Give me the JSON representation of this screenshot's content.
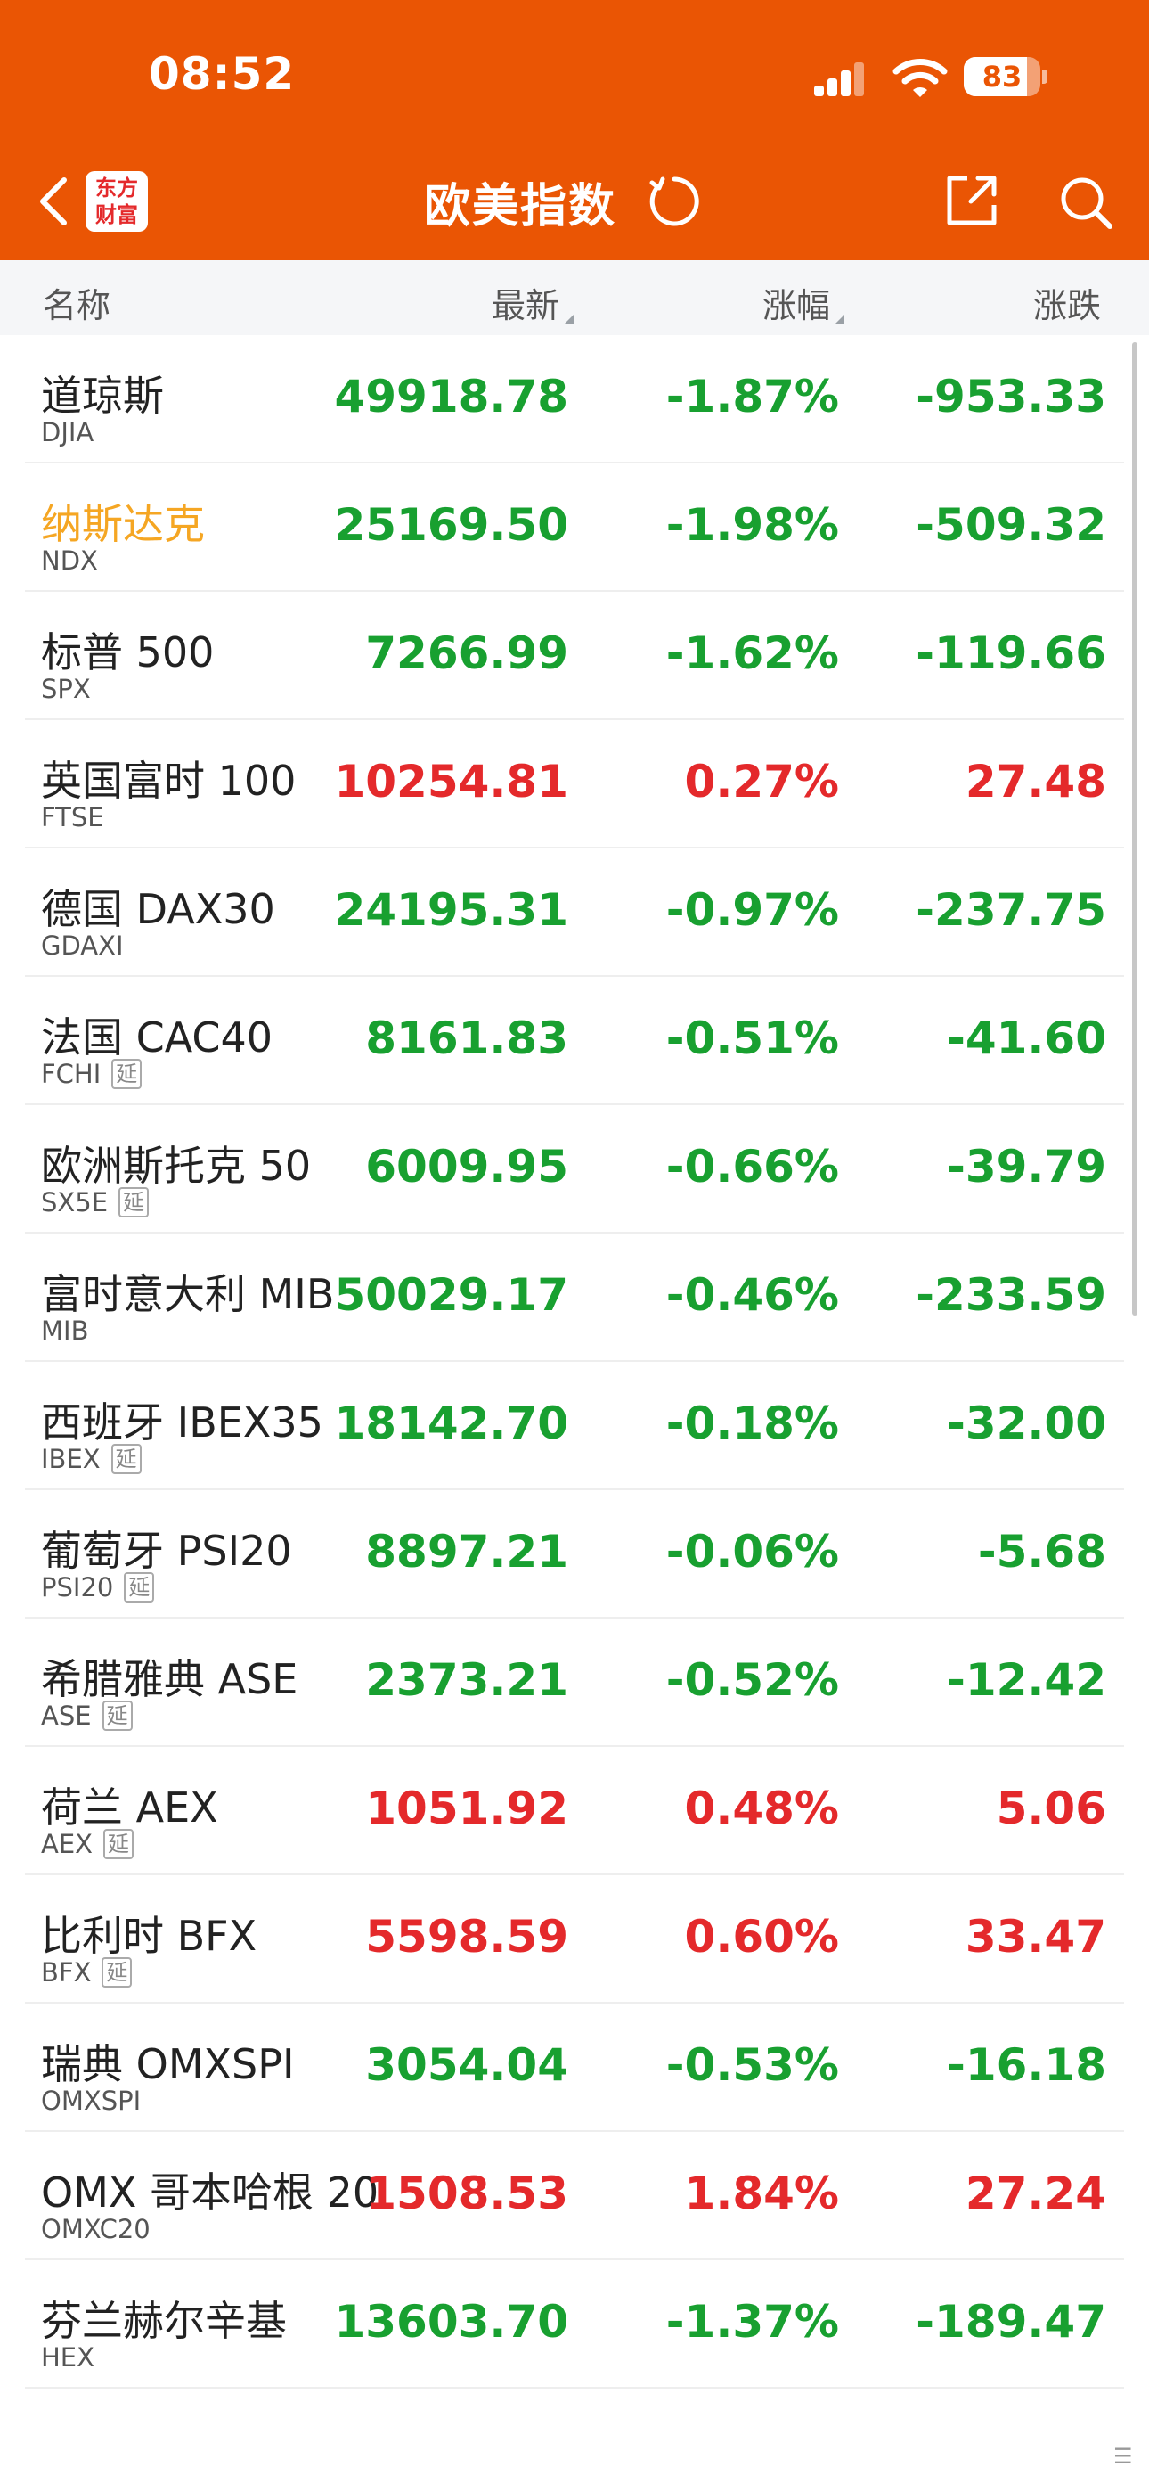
{
  "status": {
    "time": "08:52",
    "battery": "83",
    "battery_level": 0.83
  },
  "nav": {
    "title": "欧美指数",
    "logo_line1": "东方",
    "logo_line2": "财富"
  },
  "columns": {
    "name": "名称",
    "latest": "最新",
    "change_pct": "涨幅",
    "change": "涨跌"
  },
  "colors": {
    "header_bg": "#ea5504",
    "up": "#e4292b",
    "down": "#18a030",
    "highlight": "#f5a623"
  },
  "delay_badge": "延",
  "rows": [
    {
      "name": "道琼斯",
      "code": "DJIA",
      "delayed": false,
      "price": "49918.78",
      "pct": "-1.87%",
      "chg": "-953.33",
      "dir": "down",
      "highlight": false
    },
    {
      "name": "纳斯达克",
      "code": "NDX",
      "delayed": false,
      "price": "25169.50",
      "pct": "-1.98%",
      "chg": "-509.32",
      "dir": "down",
      "highlight": true
    },
    {
      "name": "标普 500",
      "code": "SPX",
      "delayed": false,
      "price": "7266.99",
      "pct": "-1.62%",
      "chg": "-119.66",
      "dir": "down",
      "highlight": false
    },
    {
      "name": "英国富时 100",
      "code": "FTSE",
      "delayed": false,
      "price": "10254.81",
      "pct": "0.27%",
      "chg": "27.48",
      "dir": "up",
      "highlight": false
    },
    {
      "name": "德国 DAX30",
      "code": "GDAXI",
      "delayed": false,
      "price": "24195.31",
      "pct": "-0.97%",
      "chg": "-237.75",
      "dir": "down",
      "highlight": false
    },
    {
      "name": "法国 CAC40",
      "code": "FCHI",
      "delayed": true,
      "price": "8161.83",
      "pct": "-0.51%",
      "chg": "-41.60",
      "dir": "down",
      "highlight": false
    },
    {
      "name": "欧洲斯托克 50",
      "code": "SX5E",
      "delayed": true,
      "price": "6009.95",
      "pct": "-0.66%",
      "chg": "-39.79",
      "dir": "down",
      "highlight": false
    },
    {
      "name": "富时意大利 MIB",
      "code": "MIB",
      "delayed": false,
      "price": "50029.17",
      "pct": "-0.46%",
      "chg": "-233.59",
      "dir": "down",
      "highlight": false
    },
    {
      "name": "西班牙 IBEX35",
      "code": "IBEX",
      "delayed": true,
      "price": "18142.70",
      "pct": "-0.18%",
      "chg": "-32.00",
      "dir": "down",
      "highlight": false
    },
    {
      "name": "葡萄牙 PSI20",
      "code": "PSI20",
      "delayed": true,
      "price": "8897.21",
      "pct": "-0.06%",
      "chg": "-5.68",
      "dir": "down",
      "highlight": false
    },
    {
      "name": "希腊雅典 ASE",
      "code": "ASE",
      "delayed": true,
      "price": "2373.21",
      "pct": "-0.52%",
      "chg": "-12.42",
      "dir": "down",
      "highlight": false
    },
    {
      "name": "荷兰 AEX",
      "code": "AEX",
      "delayed": true,
      "price": "1051.92",
      "pct": "0.48%",
      "chg": "5.06",
      "dir": "up",
      "highlight": false
    },
    {
      "name": "比利时 BFX",
      "code": "BFX",
      "delayed": true,
      "price": "5598.59",
      "pct": "0.60%",
      "chg": "33.47",
      "dir": "up",
      "highlight": false
    },
    {
      "name": "瑞典 OMXSPI",
      "code": "OMXSPI",
      "delayed": false,
      "price": "3054.04",
      "pct": "-0.53%",
      "chg": "-16.18",
      "dir": "down",
      "highlight": false
    },
    {
      "name": "OMX 哥本哈根 20",
      "code": "OMXC20",
      "delayed": false,
      "price": "1508.53",
      "pct": "1.84%",
      "chg": "27.24",
      "dir": "up",
      "highlight": false
    },
    {
      "name": "芬兰赫尔辛基",
      "code": "HEX",
      "delayed": false,
      "price": "13603.70",
      "pct": "-1.37%",
      "chg": "-189.47",
      "dir": "down",
      "highlight": false
    }
  ]
}
